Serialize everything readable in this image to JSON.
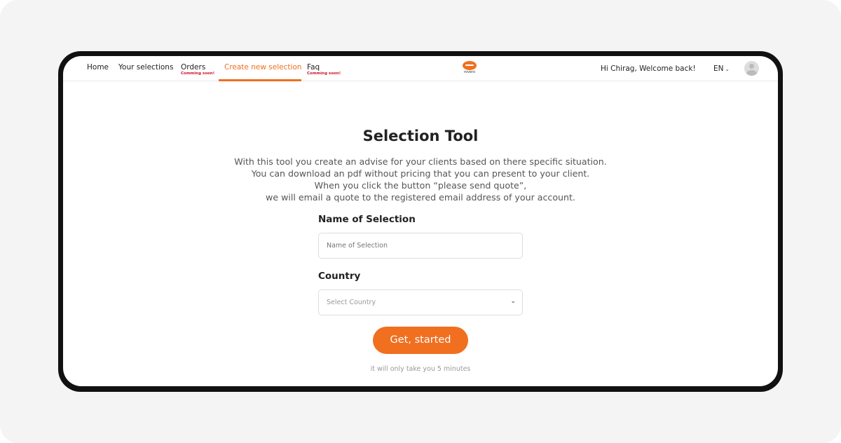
{
  "nav": {
    "items": [
      {
        "label": "Home"
      },
      {
        "label": "Your selections"
      },
      {
        "label": "Orders",
        "badge": "Comming soon!"
      },
      {
        "label": "Create new selection",
        "active": true
      },
      {
        "label": "Faq",
        "badge": "Comming soon!"
      }
    ],
    "logo_text": "rovero",
    "welcome": "Hi Chirag, Welcome back!",
    "language": "EN",
    "accent": "#f07020"
  },
  "main": {
    "title": "Selection Tool",
    "description": [
      "With this tool you create an advise for your clients based on there specific situation.",
      "You can download an pdf without pricing that you can present to your client.",
      "When you click the button “please send quote”,",
      "we will email a quote to the registered email address of your account."
    ],
    "name_label": "Name of Selection",
    "name_placeholder": "Name of Selection",
    "name_value": "",
    "country_label": "Country",
    "country_placeholder": "Select Country",
    "button": "Get, started",
    "hint": "it will only take you 5 minutes"
  }
}
